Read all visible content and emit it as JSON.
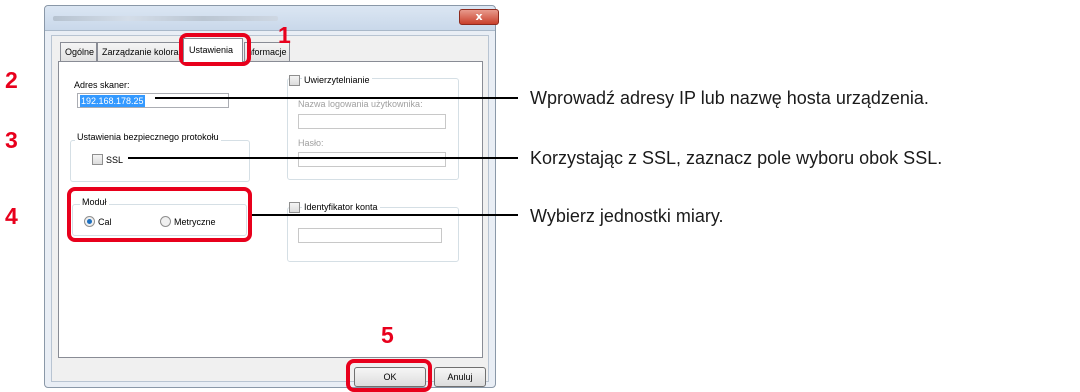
{
  "callouts": {
    "n1": "1",
    "n2": "2",
    "n3": "3",
    "n4": "4",
    "n5": "5",
    "text_ip": "Wprowadź adresy IP lub nazwę hosta urządzenia.",
    "text_ssl": "Korzystając z SSL, zaznacz pole wyboru obok SSL.",
    "text_unit": "Wybierz jednostki miary."
  },
  "window": {
    "close_glyph": "x"
  },
  "tabs": [
    {
      "label": "Ogólne"
    },
    {
      "label": "Zarządzanie kolora"
    },
    {
      "label": "Ustawienia",
      "active": true
    },
    {
      "label": "nformacje"
    }
  ],
  "scanner": {
    "address_label": "Adres skaner:",
    "address_value": "192.168.178.25"
  },
  "secure": {
    "group_label": "Ustawienia bezpiecznego protokołu",
    "ssl_label": "SSL",
    "ssl_checked": false
  },
  "unit": {
    "group_label": "Moduł",
    "options": [
      {
        "label": "Cal",
        "selected": true
      },
      {
        "label": "Metryczne",
        "selected": false
      }
    ]
  },
  "auth": {
    "label": "Uwierzytelnianie",
    "username_label": "Nazwa logowania użytkownika:",
    "password_label": "Hasło:"
  },
  "account": {
    "label": "Identyfikator konta"
  },
  "buttons": {
    "ok": "OK",
    "cancel": "Anuluj"
  },
  "colors": {
    "highlight": "#e8001c",
    "selection": "#3399ff"
  }
}
